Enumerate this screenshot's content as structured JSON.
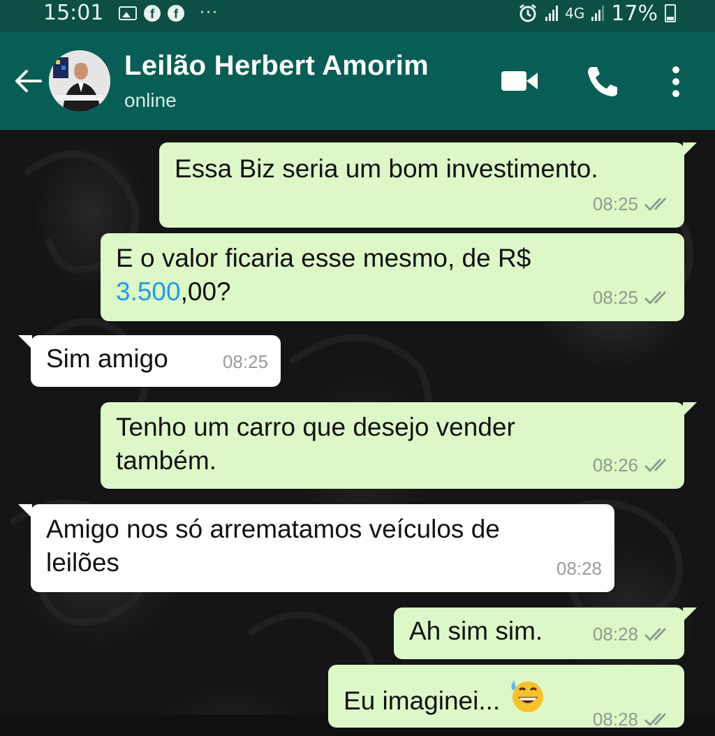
{
  "status_bar": {
    "time": "15:01",
    "network_label": "4G",
    "battery_percent": "17%",
    "icons": [
      "image-icon",
      "facebook-icon",
      "facebook-icon",
      "more-dots-icon",
      "alarm-icon",
      "signal-icon",
      "signal-icon",
      "battery-icon"
    ]
  },
  "header": {
    "contact_name": "Leilão Herbert Amorim",
    "status": "online",
    "colors": {
      "header": "#075e54",
      "status_bar": "#0b4f45"
    }
  },
  "messages": [
    {
      "direction": "outgoing",
      "text": "Essa Biz seria um bom investimento.",
      "time": "08:25",
      "ticks": "double-check"
    },
    {
      "direction": "outgoing",
      "text_line1": "E o valor ficaria esse mesmo, de R$",
      "text_link": "3.500",
      "text_after_link": ",00?",
      "time": "08:25",
      "ticks": "double-check"
    },
    {
      "direction": "incoming",
      "text": "Sim amigo",
      "time": "08:25"
    },
    {
      "direction": "outgoing",
      "text_line1": "Tenho um carro que desejo vender",
      "text_line2": "também.",
      "time": "08:26",
      "ticks": "double-check"
    },
    {
      "direction": "incoming",
      "text_line1": "Amigo nos só arrematamos veículos de",
      "text_line2": "leilões",
      "time": "08:28"
    },
    {
      "direction": "outgoing",
      "text": "Ah sim sim.",
      "time": "08:28",
      "ticks": "double-check"
    },
    {
      "direction": "outgoing",
      "text": "Eu imaginei...",
      "emoji": "grinning-sweat-emoji",
      "time": "08:28",
      "ticks": "double-check"
    }
  ],
  "colors": {
    "outgoing_bubble": "#dcf8c6",
    "incoming_bubble": "#ffffff",
    "link": "#1e9be8"
  }
}
